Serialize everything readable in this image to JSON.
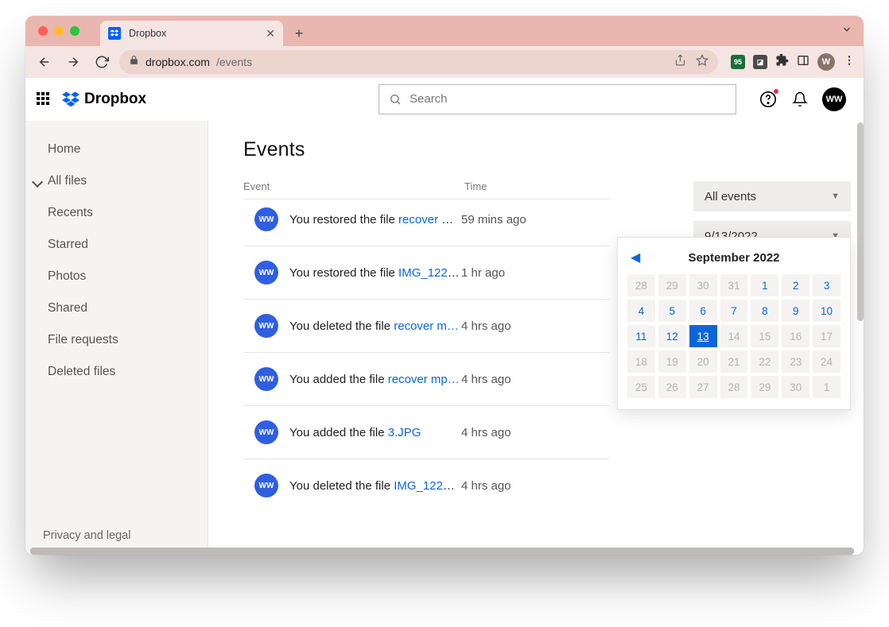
{
  "browser": {
    "tab_title": "Dropbox",
    "url_host": "dropbox.com",
    "url_path": "/events",
    "avatar_initial": "W"
  },
  "app": {
    "brand": "Dropbox",
    "search_placeholder": "Search",
    "avatar": "WW"
  },
  "sidebar": {
    "items": [
      {
        "label": "Home"
      },
      {
        "label": "All files",
        "active": true
      },
      {
        "label": "Recents"
      },
      {
        "label": "Starred"
      },
      {
        "label": "Photos"
      },
      {
        "label": "Shared"
      },
      {
        "label": "File requests"
      },
      {
        "label": "Deleted files"
      }
    ],
    "footer": "Privacy and legal"
  },
  "page": {
    "title": "Events",
    "columns": {
      "event": "Event",
      "time": "Time"
    }
  },
  "filters": {
    "scope": "All events",
    "date": "9/13/2022"
  },
  "events": [
    {
      "avatar": "WW",
      "prefix": "You restored the file ",
      "file": "recover m…",
      "time": "59 mins ago"
    },
    {
      "avatar": "WW",
      "prefix": "You restored the file ",
      "file": "IMG_1222…",
      "time": "1 hr ago"
    },
    {
      "avatar": "WW",
      "prefix": "You deleted the file ",
      "file": "recover m…",
      "time": "4 hrs ago"
    },
    {
      "avatar": "WW",
      "prefix": "You added the file ",
      "file": "recover mp…",
      "time": "4 hrs ago"
    },
    {
      "avatar": "WW",
      "prefix": "You added the file ",
      "file": "3.JPG",
      "time": "4 hrs ago"
    },
    {
      "avatar": "WW",
      "prefix": "You deleted the file ",
      "file": "IMG_1222.…",
      "time": "4 hrs ago"
    }
  ],
  "calendar": {
    "month_label": "September 2022",
    "selected": 13,
    "cells": [
      {
        "n": 28,
        "t": "prev"
      },
      {
        "n": 29,
        "t": "prev"
      },
      {
        "n": 30,
        "t": "prev"
      },
      {
        "n": 31,
        "t": "prev"
      },
      {
        "n": 1,
        "t": "cur"
      },
      {
        "n": 2,
        "t": "cur"
      },
      {
        "n": 3,
        "t": "cur"
      },
      {
        "n": 4,
        "t": "cur"
      },
      {
        "n": 5,
        "t": "cur"
      },
      {
        "n": 6,
        "t": "cur"
      },
      {
        "n": 7,
        "t": "cur"
      },
      {
        "n": 8,
        "t": "cur"
      },
      {
        "n": 9,
        "t": "cur"
      },
      {
        "n": 10,
        "t": "cur"
      },
      {
        "n": 11,
        "t": "cur"
      },
      {
        "n": 12,
        "t": "cur"
      },
      {
        "n": 13,
        "t": "sel"
      },
      {
        "n": 14,
        "t": "next"
      },
      {
        "n": 15,
        "t": "next"
      },
      {
        "n": 16,
        "t": "next"
      },
      {
        "n": 17,
        "t": "next"
      },
      {
        "n": 18,
        "t": "next"
      },
      {
        "n": 19,
        "t": "next"
      },
      {
        "n": 20,
        "t": "next"
      },
      {
        "n": 21,
        "t": "next"
      },
      {
        "n": 22,
        "t": "next"
      },
      {
        "n": 23,
        "t": "next"
      },
      {
        "n": 24,
        "t": "next"
      },
      {
        "n": 25,
        "t": "next"
      },
      {
        "n": 26,
        "t": "next"
      },
      {
        "n": 27,
        "t": "next"
      },
      {
        "n": 28,
        "t": "next"
      },
      {
        "n": 29,
        "t": "next"
      },
      {
        "n": 30,
        "t": "next"
      },
      {
        "n": 1,
        "t": "next"
      }
    ]
  }
}
